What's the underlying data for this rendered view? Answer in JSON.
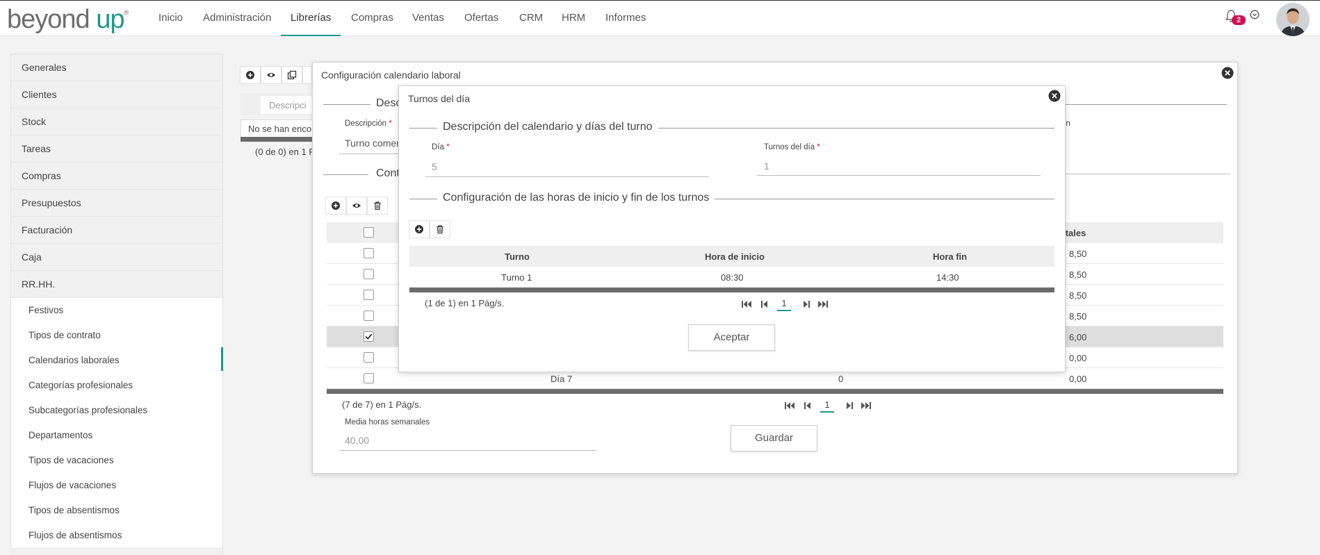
{
  "brand": {
    "part1": "beyond",
    "part2": "up",
    "mark": "®"
  },
  "nav": [
    "Inicio",
    "Administración",
    "Librerías",
    "Compras",
    "Ventas",
    "Ofertas",
    "CRM",
    "HRM",
    "Informes"
  ],
  "notifications": {
    "count": "2"
  },
  "sidebar": {
    "items": [
      "Generales",
      "Clientes",
      "Stock",
      "Tareas",
      "Compras",
      "Presupuestos",
      "Facturación",
      "Caja",
      "RR.HH."
    ],
    "subitems": [
      "Festivos",
      "Tipos de contrato",
      "Calendarios laborales",
      "Categorías profesionales",
      "Subcategorías profesionales",
      "Departamentos",
      "Tipos de vacaciones",
      "Flujos de vacaciones",
      "Tipos de absentismos",
      "Flujos de absentismos"
    ]
  },
  "background": {
    "search_placeholder": "Descripci",
    "no_results": "No se han enco",
    "pager_text": "(0 de 0) en 1 P"
  },
  "modal1": {
    "title": "Configuración calendario laboral",
    "legend1": "Desc",
    "desc_label": "Descripción",
    "desc_value": "Turno comer",
    "right_label_fragment": "ón",
    "legend2": "Cont",
    "col_total": "Horas totales",
    "rows": [
      {
        "dia": "",
        "turnos": "",
        "total": "8,50",
        "checked": false
      },
      {
        "dia": "",
        "turnos": "",
        "total": "8,50",
        "checked": false
      },
      {
        "dia": "",
        "turnos": "",
        "total": "8,50",
        "checked": false
      },
      {
        "dia": "",
        "turnos": "",
        "total": "8,50",
        "checked": false
      },
      {
        "dia": "",
        "turnos": "",
        "total": "6,00",
        "checked": true
      },
      {
        "dia": "",
        "turnos": "",
        "total": "0,00",
        "checked": false
      },
      {
        "dia": "Día 7",
        "turnos": "0",
        "total": "0,00",
        "checked": false
      }
    ],
    "pager_text": "(7 de 7) en 1 Pág/s.",
    "page": "1",
    "media_label": "Media horas semanales",
    "media_value": "40,00",
    "save_label": "Guardar"
  },
  "modal2": {
    "title": "Turnos del día",
    "legend1": "Descripción del calendario y días del turno",
    "dia_label": "Día",
    "dia_value": "5",
    "turnos_label": "Turnos del día",
    "turnos_value": "1",
    "legend2": "Configuración de las horas de inicio y fin de los turnos",
    "columns": [
      "Turno",
      "Hora de inicio",
      "Hora fin"
    ],
    "rows": [
      {
        "turno": "Turno 1",
        "inicio": "08:30",
        "fin": "14:30"
      }
    ],
    "pager_text": "(1 de 1) en 1 Pág/s.",
    "page": "1",
    "accept_label": "Aceptar"
  },
  "colors": {
    "accent": "#1b998b",
    "badge": "#d0104c",
    "pager_bar": "#6b6b6b"
  },
  "icons": [
    "add-icon",
    "view-icon",
    "copy-icon",
    "delete-icon",
    "close-icon",
    "bell-icon",
    "chevron-down-circle-icon",
    "first-page-icon",
    "prev-page-icon",
    "next-page-icon",
    "last-page-icon"
  ]
}
